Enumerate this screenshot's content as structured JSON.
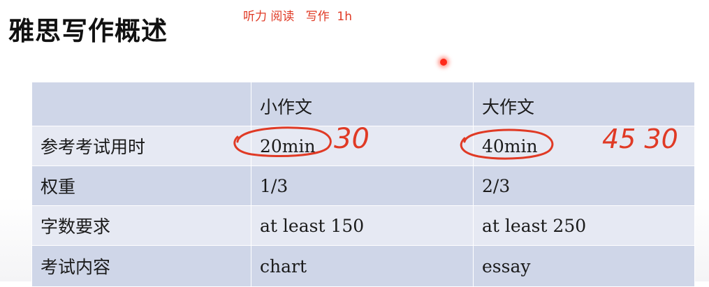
{
  "title": "雅思写作概述",
  "note": "听力 阅读   写作  1h",
  "table": {
    "headers": [
      "",
      "小作文",
      "大作文"
    ],
    "rows": [
      {
        "label": "参考考试用时",
        "task1": "20min",
        "task2": "40min"
      },
      {
        "label": "权重",
        "task1": "1/3",
        "task2": "2/3"
      },
      {
        "label": "字数要求",
        "task1": "at least 150",
        "task2": "at least 250"
      },
      {
        "label": "考试内容",
        "task1": "chart",
        "task2": "essay"
      }
    ]
  },
  "annotations": {
    "task1_time": "30",
    "task2_time": "45 30"
  },
  "colors": {
    "ink": "#e03a25",
    "header_row": "#cfd6e8",
    "alt_row": "#e6e9f3"
  }
}
